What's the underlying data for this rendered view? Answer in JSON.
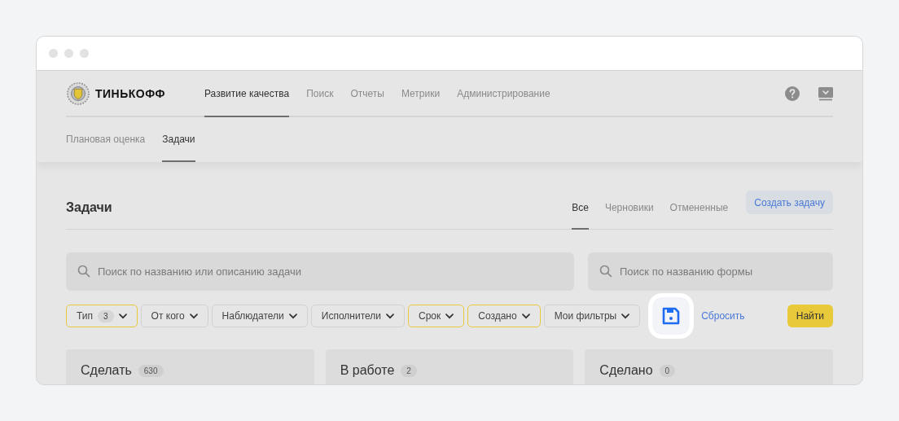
{
  "logo": {
    "text": "ТИНЬКОФФ"
  },
  "nav": [
    {
      "label": "Развитие качества",
      "selected": true
    },
    {
      "label": "Поиск",
      "selected": false
    },
    {
      "label": "Отчеты",
      "selected": false
    },
    {
      "label": "Метрики",
      "selected": false
    },
    {
      "label": "Администрирование",
      "selected": false
    }
  ],
  "subnav": [
    {
      "label": "Плановая оценка",
      "selected": false
    },
    {
      "label": "Задачи",
      "selected": true
    }
  ],
  "page_title": "Задачи",
  "view_tabs": [
    {
      "label": "Все",
      "selected": true
    },
    {
      "label": "Черновики",
      "selected": false
    },
    {
      "label": "Отмененные",
      "selected": false
    }
  ],
  "create_button": "Создать задачу",
  "search_tasks": {
    "placeholder": "Поиск по названию или описанию задачи"
  },
  "search_forms": {
    "placeholder": "Поиск по названию формы"
  },
  "filters": [
    {
      "label": "Тип",
      "count": "3",
      "active": true
    },
    {
      "label": "От кого",
      "active": false
    },
    {
      "label": "Наблюдатели",
      "active": false
    },
    {
      "label": "Исполнители",
      "active": false
    },
    {
      "label": "Срок",
      "active": true
    },
    {
      "label": "Создано",
      "active": true
    },
    {
      "label": "Мои фильтры",
      "active": false
    }
  ],
  "save_filter": {
    "highlighted": true
  },
  "reset_link": "Сбросить",
  "find_button": "Найти",
  "columns": [
    {
      "title": "Сделать",
      "count": "630"
    },
    {
      "title": "В работе",
      "count": "2"
    },
    {
      "title": "Сделано",
      "count": "0"
    }
  ]
}
